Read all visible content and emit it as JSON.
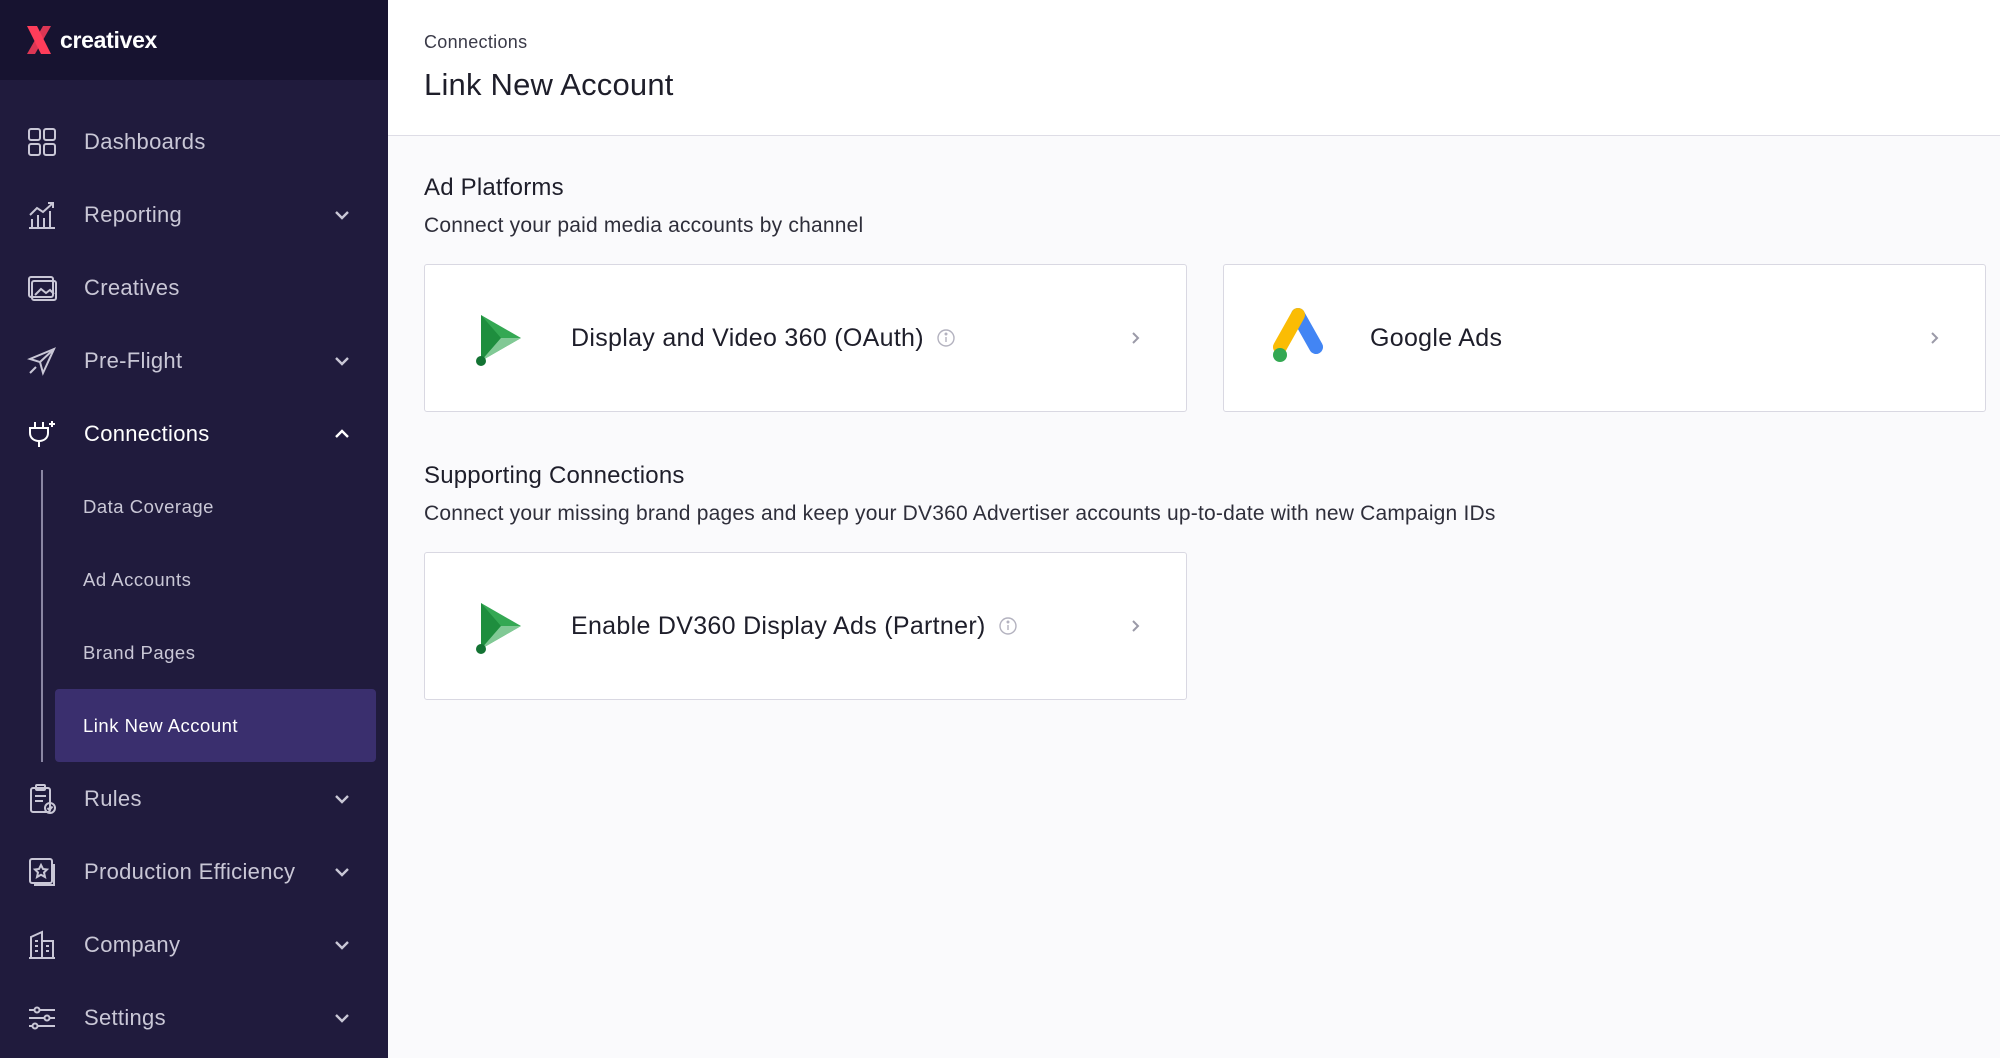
{
  "brand": {
    "name": "creativex"
  },
  "colors": {
    "sidebar_bg": "#201b3d",
    "sidebar_header_bg": "#171330",
    "active_item_bg": "#3a2f6e",
    "brand_accent": "#ff3d5a"
  },
  "sidebar": {
    "items": [
      {
        "label": "Dashboards",
        "icon": "grid-icon",
        "has_chevron": false
      },
      {
        "label": "Reporting",
        "icon": "chart-icon",
        "has_chevron": true
      },
      {
        "label": "Creatives",
        "icon": "images-icon",
        "has_chevron": false
      },
      {
        "label": "Pre-Flight",
        "icon": "paper-plane-icon",
        "has_chevron": true
      },
      {
        "label": "Connections",
        "icon": "plug-icon",
        "has_chevron": true,
        "expanded": true,
        "children": [
          {
            "label": "Data Coverage"
          },
          {
            "label": "Ad Accounts"
          },
          {
            "label": "Brand Pages"
          },
          {
            "label": "Link New Account",
            "active": true
          }
        ]
      },
      {
        "label": "Rules",
        "icon": "clipboard-check-icon",
        "has_chevron": true
      },
      {
        "label": "Production Efficiency",
        "icon": "star-frame-icon",
        "has_chevron": true
      },
      {
        "label": "Company",
        "icon": "building-icon",
        "has_chevron": true
      },
      {
        "label": "Settings",
        "icon": "sliders-icon",
        "has_chevron": true
      }
    ]
  },
  "header": {
    "breadcrumb": "Connections",
    "title": "Link New Account"
  },
  "sections": [
    {
      "title": "Ad Platforms",
      "subtitle": "Connect your paid media accounts by channel",
      "cards": [
        {
          "label": "Display and Video 360 (OAuth)",
          "logo": "dv360-logo-icon",
          "info": true
        },
        {
          "label": "Google Ads",
          "logo": "google-ads-logo-icon",
          "info": false
        }
      ]
    },
    {
      "title": "Supporting Connections",
      "subtitle": "Connect your missing brand pages and keep your DV360 Advertiser accounts up-to-date with new Campaign IDs",
      "cards": [
        {
          "label": "Enable DV360 Display Ads (Partner)",
          "logo": "dv360-logo-icon",
          "info": true
        }
      ]
    }
  ]
}
